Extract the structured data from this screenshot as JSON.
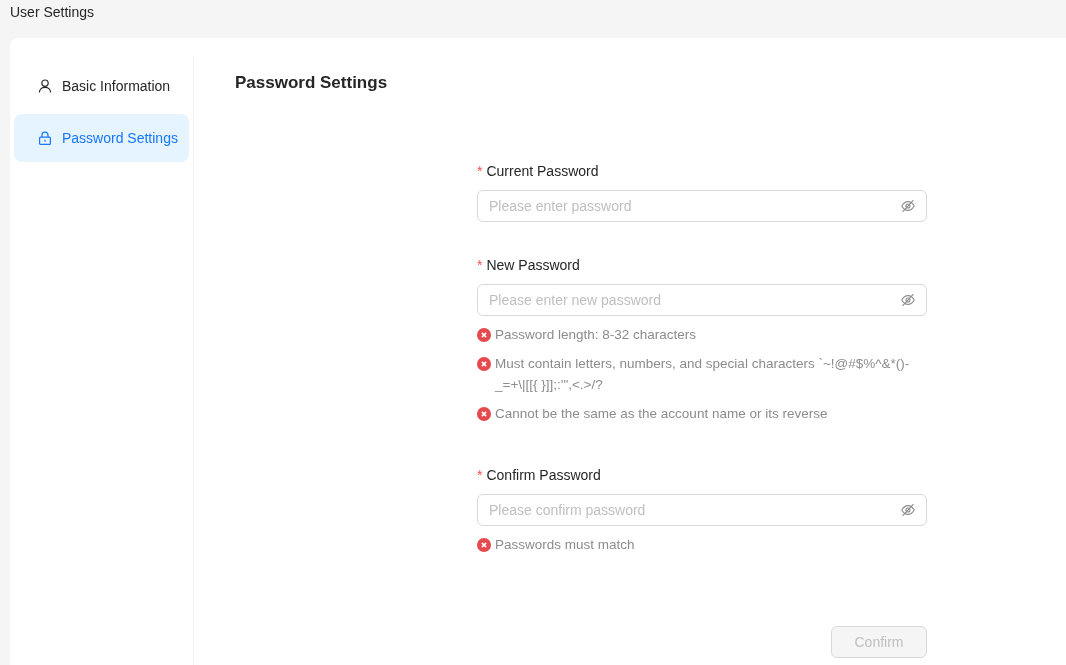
{
  "header": {
    "title": "User Settings"
  },
  "sidebar": {
    "items": [
      {
        "kind": "user",
        "label": "Basic Information",
        "selected": false
      },
      {
        "kind": "lock",
        "label": "Password Settings",
        "selected": true
      }
    ]
  },
  "content": {
    "title": "Password Settings",
    "fields": [
      {
        "required_mark": "*",
        "label": "Current Password",
        "placeholder": "Please enter password",
        "revealed": false
      },
      {
        "required_mark": "*",
        "label": "New Password",
        "placeholder": "Please enter new password",
        "revealed": false,
        "rules": [
          {
            "text": "Password length: 8-32 characters",
            "met": false
          },
          {
            "text": "Must contain letters, numbers, and special characters `~!@#$%^&*()-_=+\\|[[{ }]];:'\",<.>/?",
            "met": false
          },
          {
            "text": "Cannot be the same as the account name or its reverse",
            "met": false
          }
        ]
      },
      {
        "required_mark": "*",
        "label": "Confirm Password",
        "placeholder": "Please confirm password",
        "revealed": false,
        "rules": [
          {
            "text": "Passwords must match",
            "met": false
          }
        ]
      }
    ],
    "confirm_button": {
      "label": "Confirm",
      "disabled": true
    }
  }
}
